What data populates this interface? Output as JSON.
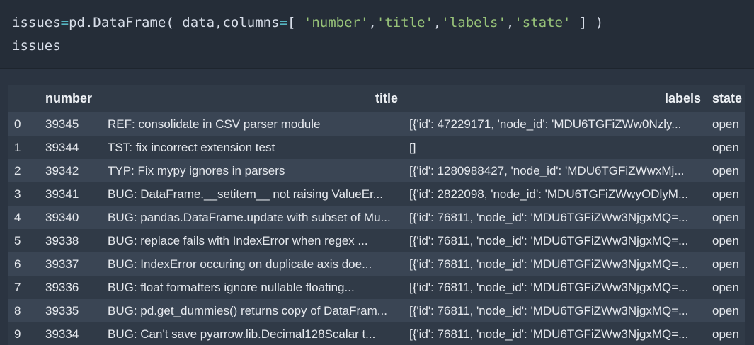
{
  "code": {
    "line1": {
      "var": "issues",
      "eq": "=",
      "call": "pd.DataFrame(",
      "arg": " data,columns",
      "eq2": "=",
      "open": "[ ",
      "s1": "'number'",
      "c1": ",",
      "s2": "'title'",
      "c2": ",",
      "s3": "'labels'",
      "c3": ",",
      "s4": "'state'",
      "close": " ] )"
    },
    "line2": "issues"
  },
  "table": {
    "columns": [
      "",
      "number",
      "title",
      "labels",
      "state"
    ],
    "rows": [
      {
        "index": "0",
        "number": "39345",
        "title": "REF: consolidate in CSV parser module",
        "labels": "[{'id': 47229171, 'node_id': 'MDU6TGFiZWw0Nzly...",
        "state": "open"
      },
      {
        "index": "1",
        "number": "39344",
        "title": "TST: fix incorrect extension test",
        "labels": "[]",
        "state": "open"
      },
      {
        "index": "2",
        "number": "39342",
        "title": "TYP: Fix mypy ignores in parsers",
        "labels": "[{'id': 1280988427, 'node_id': 'MDU6TGFiZWwxMj...",
        "state": "open"
      },
      {
        "index": "3",
        "number": "39341",
        "title": "BUG: DataFrame.__setitem__ not raising ValueEr...",
        "labels": "[{'id': 2822098, 'node_id': 'MDU6TGFiZWwyODlyM...",
        "state": "open"
      },
      {
        "index": "4",
        "number": "39340",
        "title": "BUG: pandas.DataFrame.update with subset of Mu...",
        "labels": "[{'id': 76811, 'node_id': 'MDU6TGFiZWw3NjgxMQ=...",
        "state": "open"
      },
      {
        "index": "5",
        "number": "39338",
        "title": "BUG: replace fails with IndexError when regex ...",
        "labels": "[{'id': 76811, 'node_id': 'MDU6TGFiZWw3NjgxMQ=...",
        "state": "open"
      },
      {
        "index": "6",
        "number": "39337",
        "title": "BUG: IndexError occuring on duplicate axis doe...",
        "labels": "[{'id': 76811, 'node_id': 'MDU6TGFiZWw3NjgxMQ=...",
        "state": "open"
      },
      {
        "index": "7",
        "number": "39336",
        "title": "BUG: float formatters ignore nullable floating...",
        "labels": "[{'id': 76811, 'node_id': 'MDU6TGFiZWw3NjgxMQ=...",
        "state": "open"
      },
      {
        "index": "8",
        "number": "39335",
        "title": "BUG: pd.get_dummies() returns copy of DataFram...",
        "labels": "[{'id': 76811, 'node_id': 'MDU6TGFiZWw3NjgxMQ=...",
        "state": "open"
      },
      {
        "index": "9",
        "number": "39334",
        "title": "BUG: Can't save pyarrow.lib.Decimal128Scalar t...",
        "labels": "[{'id': 76811, 'node_id': 'MDU6TGFiZWw3NjgxMQ=...",
        "state": "open"
      }
    ]
  },
  "colors": {
    "background": "#2b3441",
    "code_background": "#252d38",
    "string": "#98c379",
    "operator": "#56b6c2",
    "row_odd": "#3a4554",
    "row_even": "#303a47"
  }
}
